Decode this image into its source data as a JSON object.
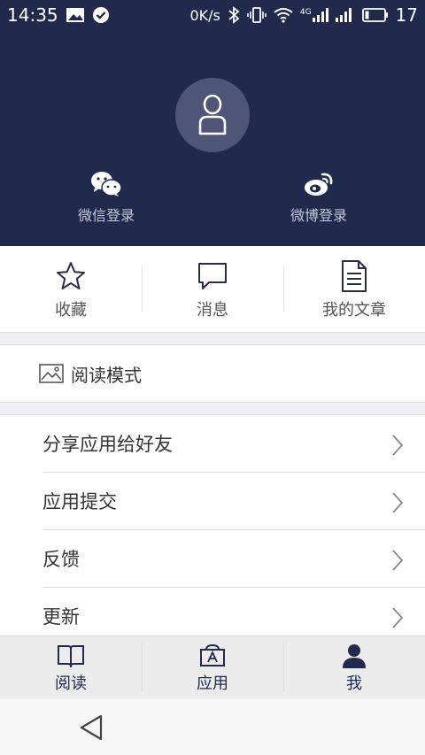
{
  "status_bar": {
    "time": "14:35",
    "network_speed": "0K/s",
    "signal_label": "4G",
    "battery": "17"
  },
  "login": {
    "wechat_label": "微信登录",
    "weibo_label": "微博登录"
  },
  "quick_actions": [
    {
      "label": "收藏",
      "icon": "star-icon"
    },
    {
      "label": "消息",
      "icon": "message-icon"
    },
    {
      "label": "我的文章",
      "icon": "document-icon"
    }
  ],
  "read_mode": {
    "label": "阅读模式",
    "icon": "image-icon"
  },
  "menu": [
    {
      "label": "分享应用给好友"
    },
    {
      "label": "应用提交"
    },
    {
      "label": "反馈"
    },
    {
      "label": "更新"
    }
  ],
  "tabs": [
    {
      "label": "阅读",
      "icon": "book-icon"
    },
    {
      "label": "应用",
      "icon": "app-store-icon"
    },
    {
      "label": "我",
      "icon": "person-icon",
      "active": true
    }
  ],
  "colors": {
    "header_bg": "#21294d",
    "accent": "#21294d",
    "divider": "#dedede"
  }
}
